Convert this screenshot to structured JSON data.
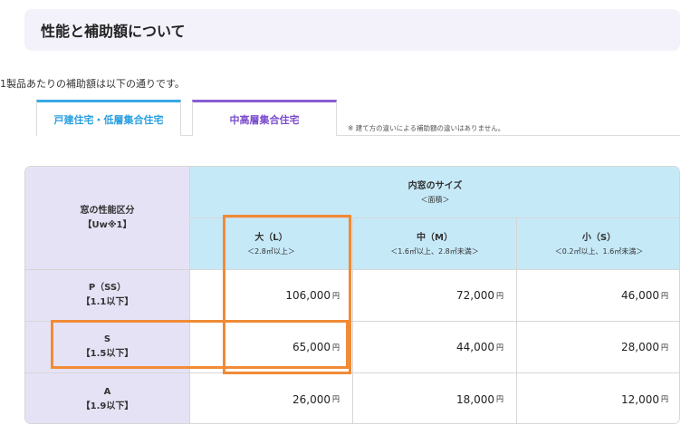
{
  "section_title": "性能と補助額について",
  "intro": "1製品あたりの補助額は以下の通りです。",
  "tabs": [
    {
      "label": "戸建住宅・低層集合住宅",
      "accent": "#3aa8e6"
    },
    {
      "label": "中高層集合住宅",
      "accent": "#8a5cd6"
    }
  ],
  "tab_note": "※ 建て方の違いによる補助額の違いはありません。",
  "table": {
    "row_header_title": "窓の性能区分",
    "row_header_sub": "【Uw※1】",
    "col_group_title": "内窓のサイズ",
    "col_group_sub": "＜面積＞",
    "columns": [
      {
        "label": "大（L）",
        "sub": "＜2.8㎡以上＞"
      },
      {
        "label": "中（M）",
        "sub": "＜1.6㎡以上、2.8㎡未満＞"
      },
      {
        "label": "小（S）",
        "sub": "＜0.2㎡以上、1.6㎡未満＞"
      }
    ],
    "rows": [
      {
        "grade": "P（SS）",
        "uw": "【1.1以下】",
        "values": [
          "106,000",
          "72,000",
          "46,000"
        ]
      },
      {
        "grade": "S",
        "uw": "【1.5以下】",
        "values": [
          "65,000",
          "44,000",
          "28,000"
        ]
      },
      {
        "grade": "A",
        "uw": "【1.9以下】",
        "values": [
          "26,000",
          "18,000",
          "12,000"
        ]
      }
    ],
    "currency": "円"
  },
  "highlight_color": "#f08b36"
}
